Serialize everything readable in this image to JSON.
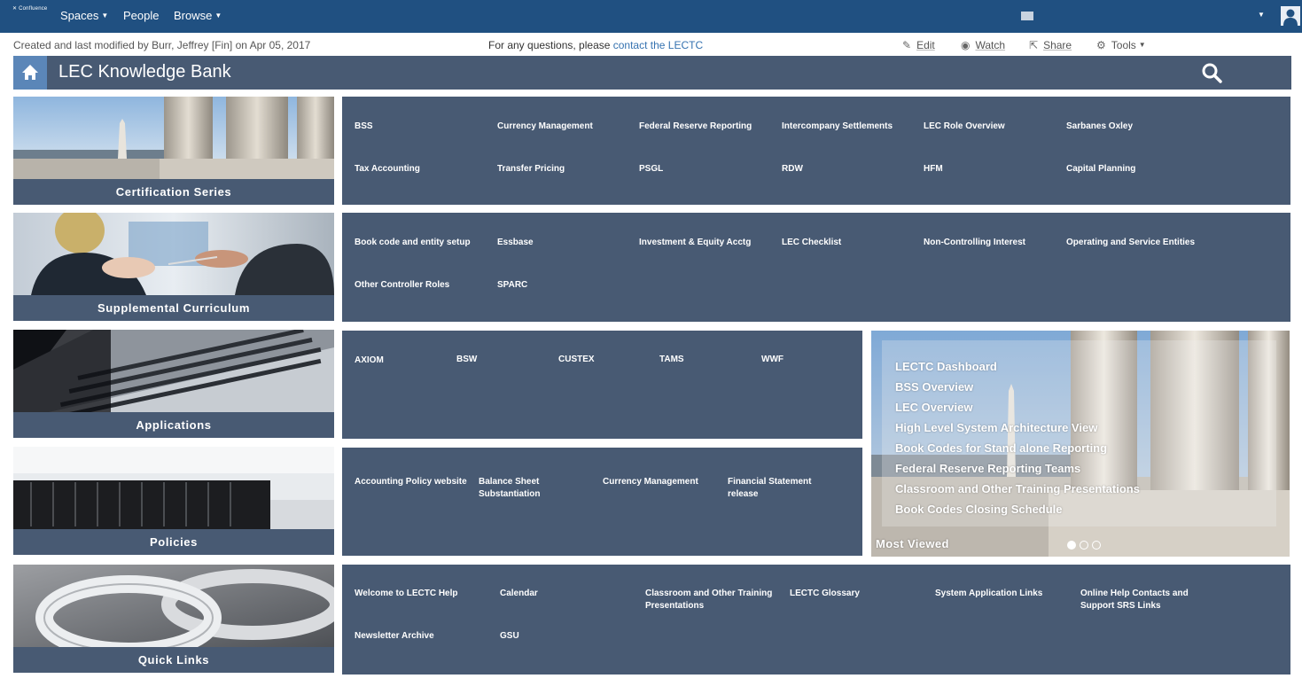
{
  "nav": {
    "logo": "Confluence",
    "spaces": "Spaces",
    "people": "People",
    "browse": "Browse"
  },
  "meta": {
    "created": "Created and last modified by Burr, Jeffrey [Fin] on Apr 05, 2017",
    "questions_prefix": "For any questions, please ",
    "questions_link": "contact the LECTC"
  },
  "actions": {
    "edit": "Edit",
    "watch": "Watch",
    "share": "Share",
    "tools": "Tools"
  },
  "title": "LEC Knowledge Bank",
  "categories": [
    {
      "label": "Certification Series"
    },
    {
      "label": "Supplemental Curriculum"
    },
    {
      "label": "Applications"
    },
    {
      "label": "Policies"
    },
    {
      "label": "Quick Links"
    }
  ],
  "panels": {
    "certification": [
      "BSS",
      "Currency Management",
      "Federal Reserve Reporting",
      "Intercompany Settlements",
      "LEC Role Overview",
      "Sarbanes Oxley",
      "Tax Accounting",
      "Transfer Pricing",
      "PSGL",
      "RDW",
      "HFM",
      "Capital Planning"
    ],
    "supplemental": [
      "Book code and entity setup",
      "Essbase",
      "Investment & Equity Acctg",
      "LEC Checklist",
      "Non-Controlling Interest",
      "Operating and Service Entities",
      "Other Controller Roles",
      "SPARC"
    ],
    "applications": [
      "AXIOM",
      "BSW",
      "CUSTEX",
      "TAMS",
      "WWF"
    ],
    "policies": [
      "Accounting Policy website",
      "Balance Sheet Substantiation",
      "Currency Management",
      "Financial Statement release"
    ],
    "quick_links": [
      "Welcome to LECTC Help",
      "Calendar",
      "Classroom and Other Training Presentations",
      "LECTC Glossary",
      "System Application Links",
      "Online Help Contacts and Support SRS Links",
      "Newsletter Archive",
      "GSU"
    ]
  },
  "most_viewed": {
    "title": "Most Viewed",
    "items": [
      "LECTC Dashboard",
      "BSS Overview",
      "LEC Overview",
      "High Level System Architecture View",
      "Book Codes for Stand alone Reporting",
      "Federal Reserve Reporting Teams",
      "Classroom and Other Training Presentations",
      "Book Codes Closing Schedule"
    ],
    "slide_count": 3,
    "active_slide": 1
  },
  "colors": {
    "header": "#205081",
    "panel": "#485a73",
    "home": "#5b86b8",
    "link": "#3572b0"
  }
}
